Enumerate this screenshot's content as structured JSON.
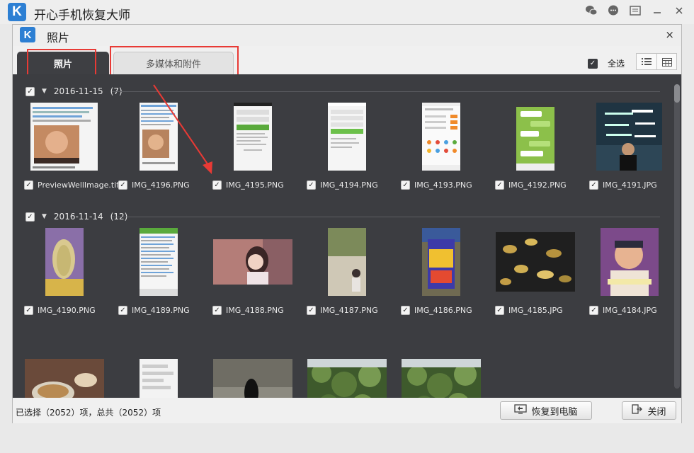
{
  "app": {
    "title": "开心手机恢复大师",
    "logo_letter": "K"
  },
  "dialog": {
    "title": "照片",
    "logo_letter": "K",
    "close_icon": "×"
  },
  "tabs": [
    {
      "label": "照片",
      "active": true
    },
    {
      "label": "多媒体和附件",
      "active": false
    }
  ],
  "select_all": {
    "label": "全选",
    "checked": true
  },
  "groups": [
    {
      "date": "2016-11-15",
      "count": "(7)",
      "checked": true,
      "items": [
        {
          "name": "PreviewWellImage.tif",
          "checked": true
        },
        {
          "name": "IMG_4196.PNG",
          "checked": true
        },
        {
          "name": "IMG_4195.PNG",
          "checked": true
        },
        {
          "name": "IMG_4194.PNG",
          "checked": true
        },
        {
          "name": "IMG_4193.PNG",
          "checked": true
        },
        {
          "name": "IMG_4192.PNG",
          "checked": true
        },
        {
          "name": "IMG_4191.JPG",
          "checked": true
        }
      ]
    },
    {
      "date": "2016-11-14",
      "count": "(12)",
      "checked": true,
      "items": [
        {
          "name": "IMG_4190.PNG",
          "checked": true
        },
        {
          "name": "IMG_4189.PNG",
          "checked": true
        },
        {
          "name": "IMG_4188.PNG",
          "checked": true
        },
        {
          "name": "IMG_4187.PNG",
          "checked": true
        },
        {
          "name": "IMG_4186.PNG",
          "checked": true
        },
        {
          "name": "IMG_4185.JPG",
          "checked": true
        },
        {
          "name": "IMG_4184.JPG",
          "checked": true
        }
      ]
    }
  ],
  "status": "已选择（2052）项，总共（2052）项",
  "buttons": {
    "restore": "恢复到电脑",
    "close": "关闭"
  },
  "colors": {
    "accent": "#2d7fd3",
    "panel": "#3c3d41",
    "highlight": "#e83a35"
  }
}
